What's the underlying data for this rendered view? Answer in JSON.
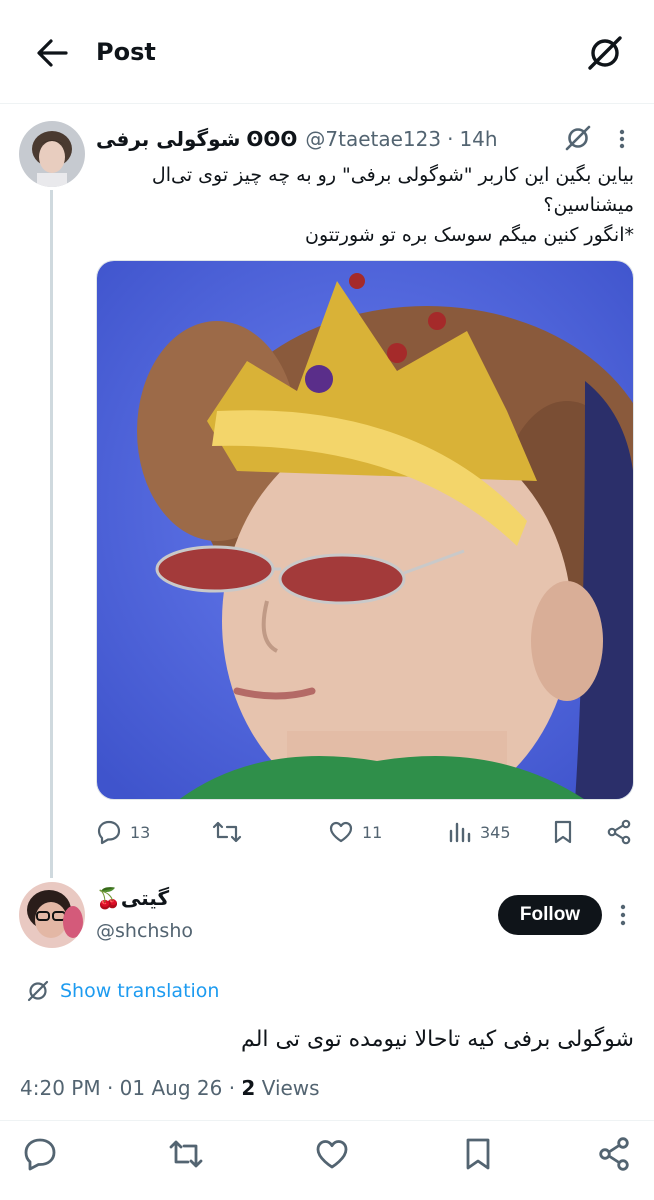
{
  "topbar": {
    "title": "Post"
  },
  "post1": {
    "display_name": "شوگولی برفی",
    "badge": "ʘʘʘ",
    "handle": "@7taetae123",
    "time": "14h",
    "text_line1": "بیاین بگین این کاربر \"شوگولی برفی\" رو به چه چیز توی تی‌ال",
    "text_line2": "میشناسین؟",
    "text_line3": "*انگور کنین میگم سوسک بره تو شورتتون",
    "replies": "13",
    "likes": "11",
    "views": "345"
  },
  "post2": {
    "display_name": "گیتی🍒",
    "handle": "@shchsho",
    "follow_label": "Follow",
    "show_translation": "Show translation",
    "text": "شوگولی برفی کیه تاحالا نیومده توی تی الم",
    "time": "4:20 PM",
    "date": "01 Aug 26",
    "views_count": "2",
    "views_label": "Views"
  },
  "colors": {
    "accent": "#1d9bf0",
    "text": "#0f1419",
    "muted": "#536471",
    "media_bg": "#4d63d8"
  },
  "icons": [
    "back-arrow-icon",
    "grok-icon",
    "more-icon",
    "reply-icon",
    "repost-icon",
    "like-icon",
    "views-icon",
    "bookmark-icon",
    "share-icon",
    "translate-icon"
  ]
}
